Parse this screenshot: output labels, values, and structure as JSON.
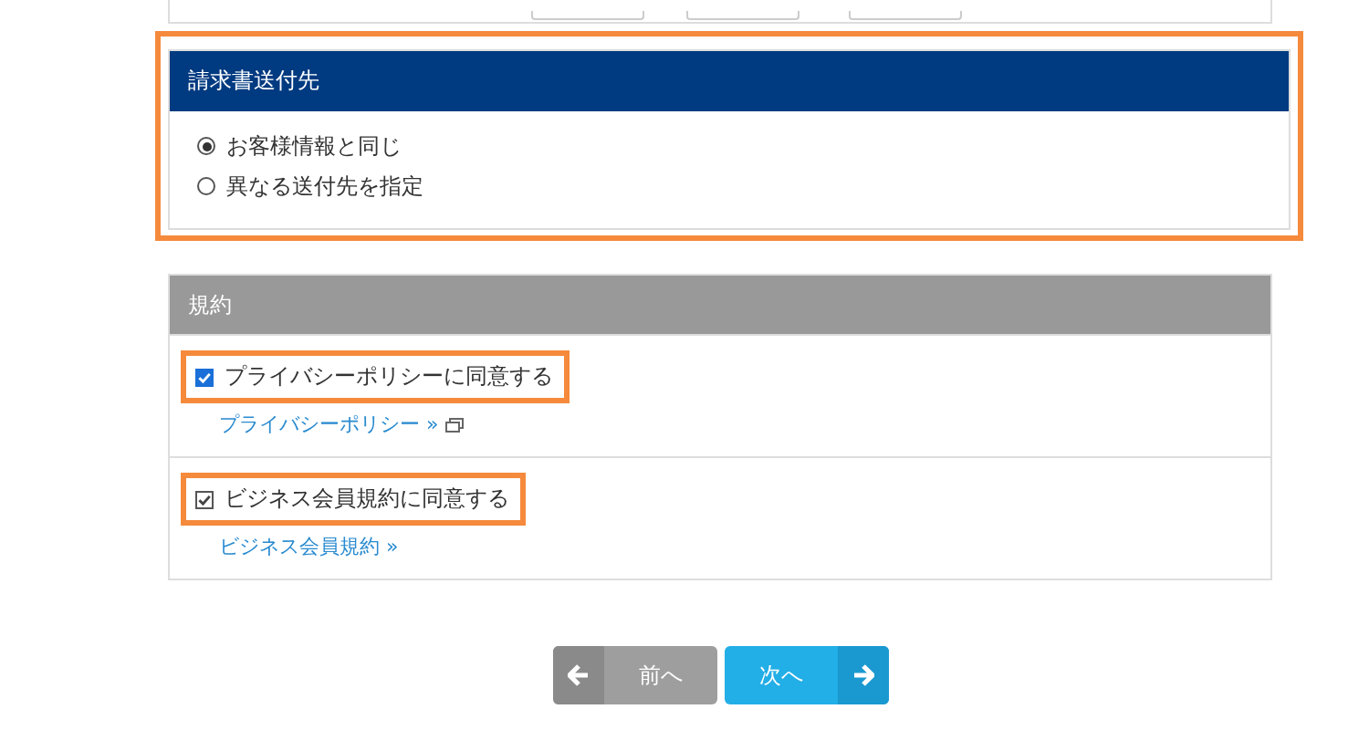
{
  "billing_section": {
    "title": "請求書送付先",
    "highlighted": true,
    "options": [
      {
        "label": "お客様情報と同じ",
        "selected": true
      },
      {
        "label": "異なる送付先を指定",
        "selected": false
      }
    ]
  },
  "terms_section": {
    "title": "規約",
    "items": [
      {
        "label": "プライバシーポリシーに同意する",
        "checked": true,
        "disabled": false,
        "highlighted": true,
        "link": "プライバシーポリシー »",
        "external": true
      },
      {
        "label": "ビジネス会員規約に同意する",
        "checked": true,
        "disabled": true,
        "highlighted": true,
        "link": "ビジネス会員規約 »",
        "external": false
      }
    ]
  },
  "buttons": [
    {
      "label": "前へ",
      "kind": "prev"
    },
    {
      "label": "次へ",
      "kind": "next"
    }
  ]
}
